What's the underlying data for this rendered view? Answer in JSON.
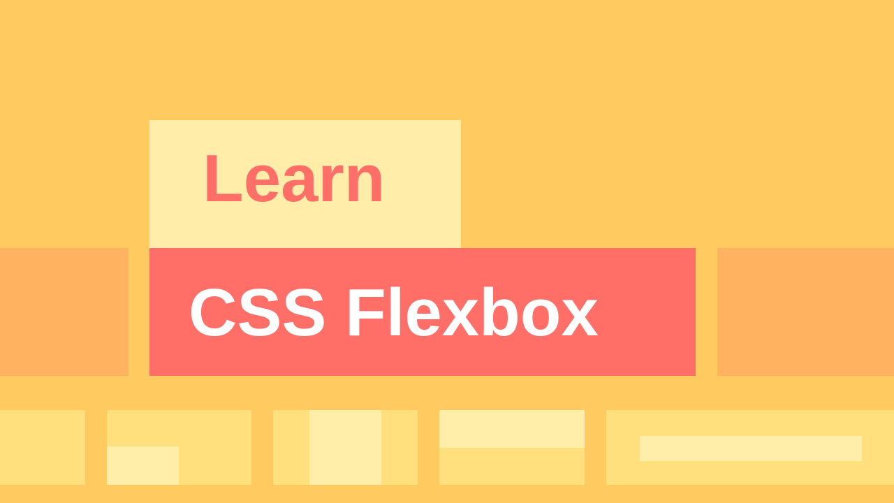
{
  "banner": {
    "line1": "Learn",
    "line2": "CSS Flexbox"
  },
  "colors": {
    "background": "#FFCA5F",
    "learn_box": "#FFEDA9",
    "learn_text": "#FF6F68",
    "flexbox_box": "#FF6F68",
    "flexbox_text": "#FFFFFF",
    "side_blocks": "#FFB25F",
    "bottom_blocks": "#FFE07C",
    "bottom_highlights": "#FFEEAA"
  }
}
